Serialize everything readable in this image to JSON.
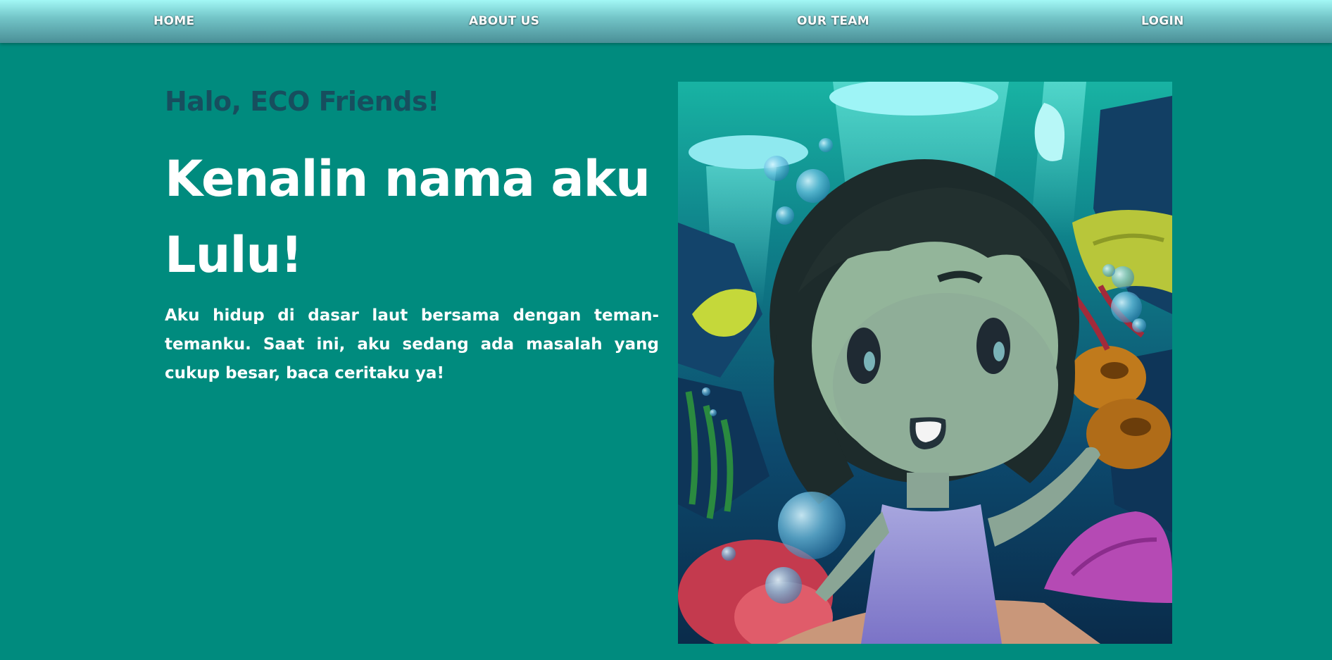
{
  "nav": {
    "items": [
      {
        "label": "HOME"
      },
      {
        "label": "ABOUT US"
      },
      {
        "label": "OUR TEAM"
      },
      {
        "label": "LOGIN"
      }
    ]
  },
  "hero": {
    "greeting": "Halo, ECO Friends!",
    "headline_line1": "Kenalin nama aku",
    "headline_line2": "Lulu!",
    "body": "Aku hidup di dasar laut bersama dengan teman-temanku. Saat ini, aku sedang ada masalah yang cukup besar, baca ceritaku ya!"
  },
  "colors": {
    "page_background": "#008b7e",
    "greeting_text": "#174e5e",
    "nav_gradient_top": "#a2f7f5",
    "nav_gradient_bottom": "#4a8f96"
  }
}
